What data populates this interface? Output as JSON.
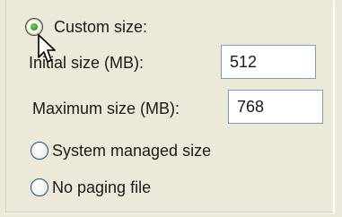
{
  "options": {
    "custom_size_label": "Custom size:",
    "system_managed_label": "System managed size",
    "no_paging_label": "No paging file"
  },
  "fields": {
    "initial_label": "Initial size (MB):",
    "initial_value": "512",
    "maximum_label": "Maximum size (MB):",
    "maximum_value": "768"
  },
  "selected_option": "custom_size",
  "colors": {
    "panel_background": "#ece9d8",
    "radio_border": "#1c5180",
    "radio_dot": "#3f9a2f",
    "textbox_border": "#7f9db9"
  }
}
